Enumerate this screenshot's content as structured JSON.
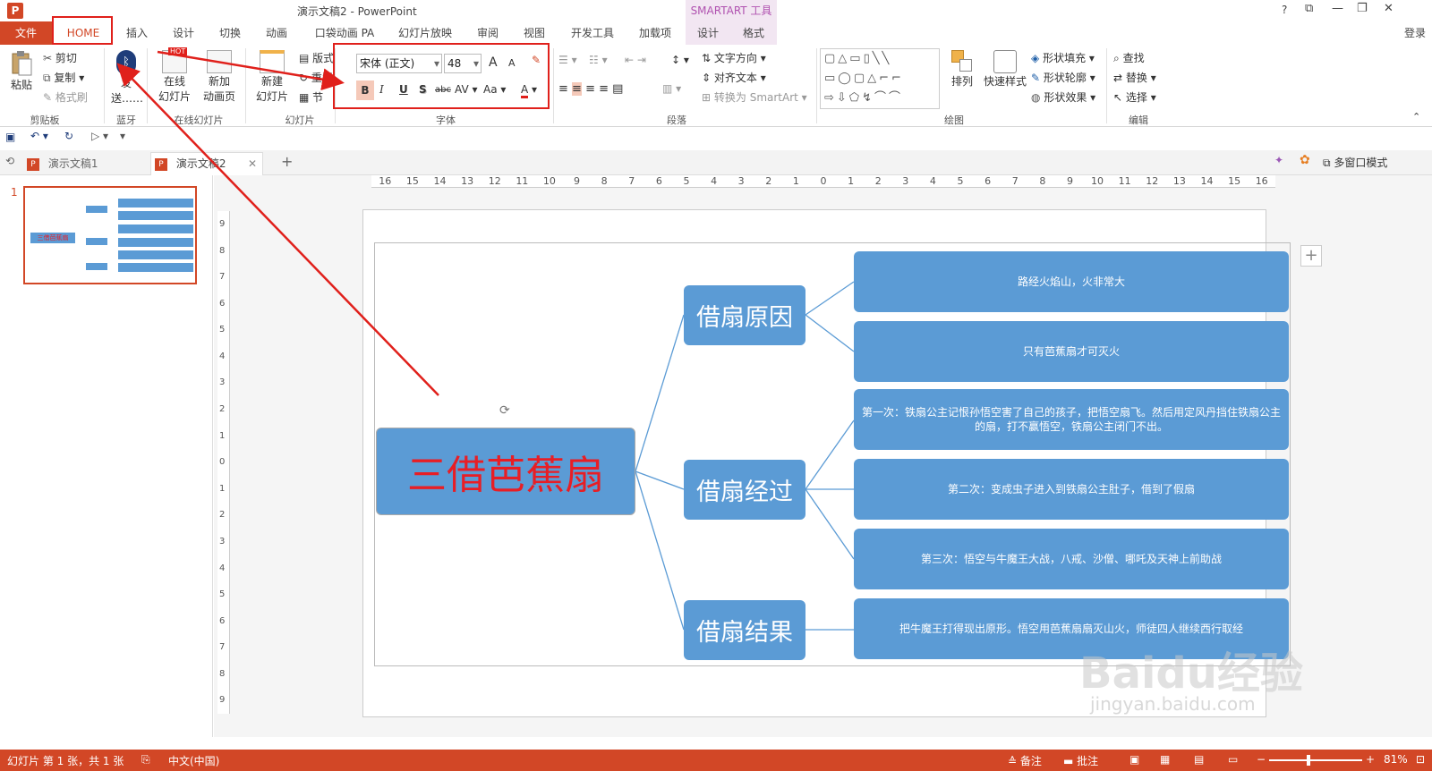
{
  "app": {
    "title": "演示文稿2 - PowerPoint",
    "context_group": "SMARTART 工具",
    "login": "登录",
    "window_btns": [
      "?",
      "⧉",
      "—",
      "❐",
      "✕"
    ]
  },
  "tabs": {
    "file": "文件",
    "home": "HOME",
    "insert": "插入",
    "design": "设计",
    "transitions": "切换",
    "animations": "动画",
    "pocket": "口袋动画 PA",
    "slideshow": "幻灯片放映",
    "review": "审阅",
    "view": "视图",
    "developer": "开发工具",
    "addins": "加载项",
    "smart_design": "设计",
    "smart_format": "格式"
  },
  "ribbon": {
    "clipboard": {
      "paste": "粘贴",
      "cut": "剪切",
      "copy": "复制",
      "format_painter": "格式刷",
      "label": "剪贴板"
    },
    "bluetooth": {
      "send": "发",
      "send2": "送……",
      "label": "蓝牙"
    },
    "online": {
      "online_slides": "在线",
      "online_slides2": "幻灯片",
      "new_anim": "新加",
      "new_anim2": "动画页",
      "label": "在线幻灯片",
      "hot": "HOT"
    },
    "slides": {
      "new_slide": "新建",
      "new_slide2": "幻灯片",
      "layout": "版式",
      "reset": "重置",
      "section": "节",
      "label": "幻灯片"
    },
    "font": {
      "name": "宋体 (正文)",
      "size": "48",
      "grow": "A",
      "shrink": "A",
      "clear": "A",
      "bold": "B",
      "italic": "I",
      "underline": "U",
      "shadow": "S",
      "strike": "abc",
      "spacing": "AV",
      "case": "Aa",
      "color": "A",
      "label": "字体"
    },
    "paragraph": {
      "text_direction": "文字方向",
      "align_text": "对齐文本",
      "convert": "转换为 SmartArt",
      "label": "段落"
    },
    "drawing": {
      "arrange": "排列",
      "quick_styles": "快速样式",
      "shape_fill": "形状填充",
      "shape_outline": "形状轮廓",
      "shape_effects": "形状效果",
      "label": "绘图"
    },
    "editing": {
      "find": "查找",
      "replace": "替换",
      "select": "选择",
      "label": "编辑"
    }
  },
  "doc_tabs": [
    {
      "label": "演示文稿1"
    },
    {
      "label": "演示文稿2"
    }
  ],
  "doc_tab_add": "+",
  "multiwindow": "多窗口模式",
  "ruler": {
    "h": [
      "16",
      "15",
      "14",
      "13",
      "12",
      "11",
      "10",
      "9",
      "8",
      "7",
      "6",
      "5",
      "4",
      "3",
      "2",
      "1",
      "0",
      "1",
      "2",
      "3",
      "4",
      "5",
      "6",
      "7",
      "8",
      "9",
      "10",
      "11",
      "12",
      "13",
      "14",
      "15",
      "16"
    ],
    "v": [
      "9",
      "8",
      "7",
      "6",
      "5",
      "4",
      "3",
      "2",
      "1",
      "0",
      "1",
      "2",
      "3",
      "4",
      "5",
      "6",
      "7",
      "8",
      "9"
    ]
  },
  "thumb": {
    "num": "1",
    "title": "三借芭蕉扇"
  },
  "smartart": {
    "root": "三借芭蕉扇",
    "branches": [
      {
        "label": "借扇原因",
        "items": [
          "路经火焰山，火非常大",
          "只有芭蕉扇才可灭火"
        ]
      },
      {
        "label": "借扇经过",
        "items": [
          "第一次：铁扇公主记恨孙悟空害了自己的孩子，把悟空扇飞。然后用定风丹挡住铁扇公主的扇，打不赢悟空，铁扇公主闭门不出。",
          "第二次：变成虫子进入到铁扇公主肚子，借到了假扇",
          "第三次：悟空与牛魔王大战，八戒、沙僧、哪吒及天神上前助战"
        ]
      },
      {
        "label": "借扇结果",
        "items": [
          "把牛魔王打得现出原形。悟空用芭蕉扇扇灭山火，师徒四人继续西行取经"
        ]
      }
    ]
  },
  "watermark": {
    "brand": "Baidu经验",
    "url": "jingyan.baidu.com"
  },
  "status": {
    "slide": "幻灯片 第 1 张，共 1 张",
    "lang": "中文(中国)",
    "notes": "备注",
    "comments": "批注",
    "zoom": "81%",
    "zoom_level": 0.81
  },
  "colors": {
    "accent": "#d24726",
    "node": "#5b9bd5",
    "annot": "#e0201b",
    "root_text": "#e81e25"
  }
}
